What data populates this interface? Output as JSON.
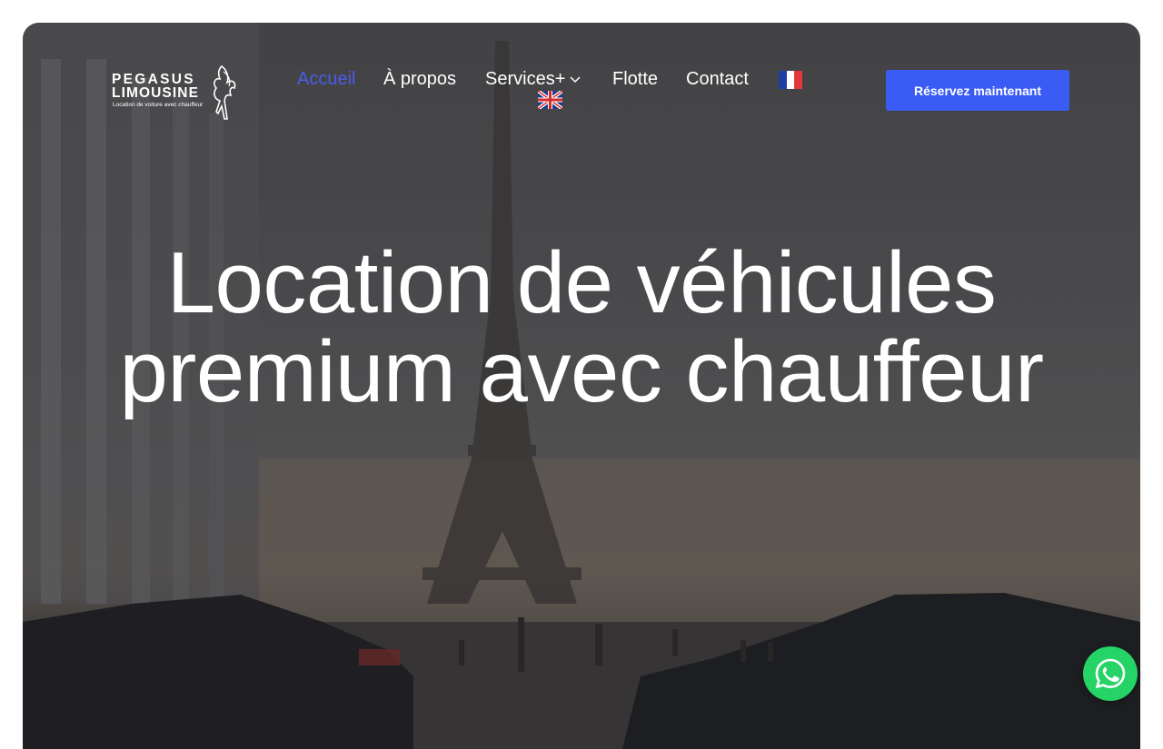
{
  "brand": {
    "name_line1": "PEGASUS",
    "name_line2": "LIMOUSINE",
    "tagline": "Location de voiture avec chauffeur"
  },
  "nav": {
    "items": [
      {
        "label": "Accueil",
        "active": true
      },
      {
        "label": "À propos",
        "active": false
      },
      {
        "label": "Services+",
        "active": false
      },
      {
        "label": "Flotte",
        "active": false
      },
      {
        "label": "Contact",
        "active": false
      }
    ],
    "languages": [
      "fr",
      "en"
    ]
  },
  "cta": {
    "label": "Réservez maintenant"
  },
  "hero": {
    "headline_line1": "Location de véhicules",
    "headline_line2": "premium avec chauffeur"
  },
  "colors": {
    "accent": "#3a5cf5",
    "active_nav": "#4a5ce8",
    "whatsapp": "#25d366"
  },
  "icons": {
    "chat": "whatsapp-icon",
    "dropdown": "chevron-down-icon"
  }
}
